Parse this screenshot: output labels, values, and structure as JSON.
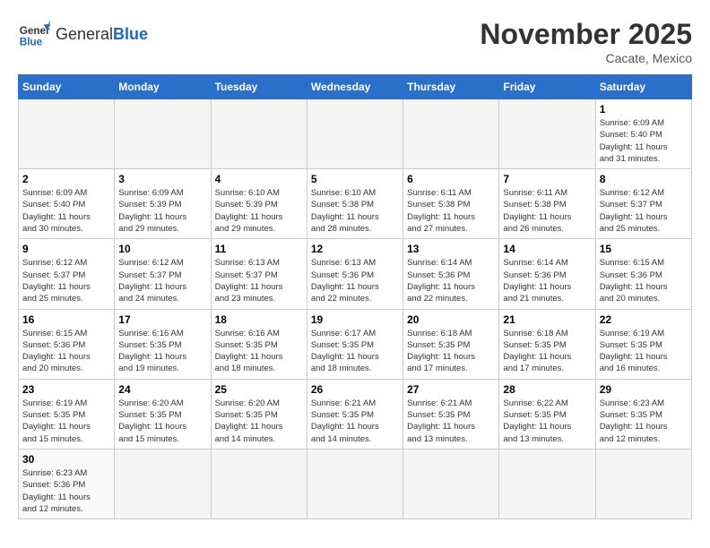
{
  "header": {
    "logo_general": "General",
    "logo_blue": "Blue",
    "month_title": "November 2025",
    "location": "Cacate, Mexico"
  },
  "days_of_week": [
    "Sunday",
    "Monday",
    "Tuesday",
    "Wednesday",
    "Thursday",
    "Friday",
    "Saturday"
  ],
  "weeks": [
    [
      {
        "day": "",
        "info": ""
      },
      {
        "day": "",
        "info": ""
      },
      {
        "day": "",
        "info": ""
      },
      {
        "day": "",
        "info": ""
      },
      {
        "day": "",
        "info": ""
      },
      {
        "day": "",
        "info": ""
      },
      {
        "day": "1",
        "info": "Sunrise: 6:09 AM\nSunset: 5:40 PM\nDaylight: 11 hours\nand 31 minutes."
      }
    ],
    [
      {
        "day": "2",
        "info": "Sunrise: 6:09 AM\nSunset: 5:40 PM\nDaylight: 11 hours\nand 30 minutes."
      },
      {
        "day": "3",
        "info": "Sunrise: 6:09 AM\nSunset: 5:39 PM\nDaylight: 11 hours\nand 29 minutes."
      },
      {
        "day": "4",
        "info": "Sunrise: 6:10 AM\nSunset: 5:39 PM\nDaylight: 11 hours\nand 29 minutes."
      },
      {
        "day": "5",
        "info": "Sunrise: 6:10 AM\nSunset: 5:38 PM\nDaylight: 11 hours\nand 28 minutes."
      },
      {
        "day": "6",
        "info": "Sunrise: 6:11 AM\nSunset: 5:38 PM\nDaylight: 11 hours\nand 27 minutes."
      },
      {
        "day": "7",
        "info": "Sunrise: 6:11 AM\nSunset: 5:38 PM\nDaylight: 11 hours\nand 26 minutes."
      },
      {
        "day": "8",
        "info": "Sunrise: 6:12 AM\nSunset: 5:37 PM\nDaylight: 11 hours\nand 25 minutes."
      }
    ],
    [
      {
        "day": "9",
        "info": "Sunrise: 6:12 AM\nSunset: 5:37 PM\nDaylight: 11 hours\nand 25 minutes."
      },
      {
        "day": "10",
        "info": "Sunrise: 6:12 AM\nSunset: 5:37 PM\nDaylight: 11 hours\nand 24 minutes."
      },
      {
        "day": "11",
        "info": "Sunrise: 6:13 AM\nSunset: 5:37 PM\nDaylight: 11 hours\nand 23 minutes."
      },
      {
        "day": "12",
        "info": "Sunrise: 6:13 AM\nSunset: 5:36 PM\nDaylight: 11 hours\nand 22 minutes."
      },
      {
        "day": "13",
        "info": "Sunrise: 6:14 AM\nSunset: 5:36 PM\nDaylight: 11 hours\nand 22 minutes."
      },
      {
        "day": "14",
        "info": "Sunrise: 6:14 AM\nSunset: 5:36 PM\nDaylight: 11 hours\nand 21 minutes."
      },
      {
        "day": "15",
        "info": "Sunrise: 6:15 AM\nSunset: 5:36 PM\nDaylight: 11 hours\nand 20 minutes."
      }
    ],
    [
      {
        "day": "16",
        "info": "Sunrise: 6:15 AM\nSunset: 5:36 PM\nDaylight: 11 hours\nand 20 minutes."
      },
      {
        "day": "17",
        "info": "Sunrise: 6:16 AM\nSunset: 5:35 PM\nDaylight: 11 hours\nand 19 minutes."
      },
      {
        "day": "18",
        "info": "Sunrise: 6:16 AM\nSunset: 5:35 PM\nDaylight: 11 hours\nand 18 minutes."
      },
      {
        "day": "19",
        "info": "Sunrise: 6:17 AM\nSunset: 5:35 PM\nDaylight: 11 hours\nand 18 minutes."
      },
      {
        "day": "20",
        "info": "Sunrise: 6:18 AM\nSunset: 5:35 PM\nDaylight: 11 hours\nand 17 minutes."
      },
      {
        "day": "21",
        "info": "Sunrise: 6:18 AM\nSunset: 5:35 PM\nDaylight: 11 hours\nand 17 minutes."
      },
      {
        "day": "22",
        "info": "Sunrise: 6:19 AM\nSunset: 5:35 PM\nDaylight: 11 hours\nand 16 minutes."
      }
    ],
    [
      {
        "day": "23",
        "info": "Sunrise: 6:19 AM\nSunset: 5:35 PM\nDaylight: 11 hours\nand 15 minutes."
      },
      {
        "day": "24",
        "info": "Sunrise: 6:20 AM\nSunset: 5:35 PM\nDaylight: 11 hours\nand 15 minutes."
      },
      {
        "day": "25",
        "info": "Sunrise: 6:20 AM\nSunset: 5:35 PM\nDaylight: 11 hours\nand 14 minutes."
      },
      {
        "day": "26",
        "info": "Sunrise: 6:21 AM\nSunset: 5:35 PM\nDaylight: 11 hours\nand 14 minutes."
      },
      {
        "day": "27",
        "info": "Sunrise: 6:21 AM\nSunset: 5:35 PM\nDaylight: 11 hours\nand 13 minutes."
      },
      {
        "day": "28",
        "info": "Sunrise: 6:22 AM\nSunset: 5:35 PM\nDaylight: 11 hours\nand 13 minutes."
      },
      {
        "day": "29",
        "info": "Sunrise: 6:23 AM\nSunset: 5:35 PM\nDaylight: 11 hours\nand 12 minutes."
      }
    ],
    [
      {
        "day": "30",
        "info": "Sunrise: 6:23 AM\nSunset: 5:36 PM\nDaylight: 11 hours\nand 12 minutes."
      },
      {
        "day": "",
        "info": ""
      },
      {
        "day": "",
        "info": ""
      },
      {
        "day": "",
        "info": ""
      },
      {
        "day": "",
        "info": ""
      },
      {
        "day": "",
        "info": ""
      },
      {
        "day": "",
        "info": ""
      }
    ]
  ]
}
